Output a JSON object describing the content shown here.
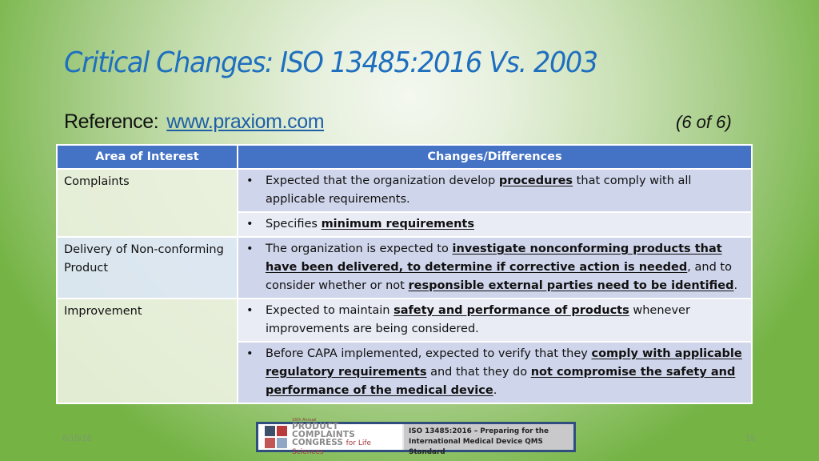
{
  "slide": {
    "title": "Critical Changes:  ISO 13485:2016 Vs. 2003",
    "reference_label": "Reference:",
    "reference_link": "www.praxiom.com",
    "pager": "(6 of 6)"
  },
  "table": {
    "headers": [
      "Area of Interest",
      "Changes/Differences"
    ],
    "rows": [
      {
        "area": "Complaints",
        "changes": [
          [
            {
              "t": "Expected that the organization develop "
            },
            {
              "t": "procedures",
              "b": true
            },
            {
              "t": " that comply with all applicable requirements."
            }
          ],
          [
            {
              "t": "Specifies "
            },
            {
              "t": "minimum requirements",
              "b": true
            }
          ]
        ]
      },
      {
        "area": "Delivery of Non-conforming Product",
        "changes": [
          [
            {
              "t": "The organization is expected to "
            },
            {
              "t": "investigate nonconforming products that have been delivered, to determine if corrective action is needed",
              "b": true
            },
            {
              "t": ", and to consider whether or not "
            },
            {
              "t": "responsible external parties need to be identified",
              "b": true
            },
            {
              "t": "."
            }
          ]
        ]
      },
      {
        "area": "Improvement",
        "changes": [
          [
            {
              "t": "Expected to maintain "
            },
            {
              "t": "safety and performance of products",
              "b": true
            },
            {
              "t": " whenever improvements are being considered."
            }
          ],
          [
            {
              "t": "Before CAPA implemented, expected to verify that they "
            },
            {
              "t": "comply with applicable regulatory requirements",
              "b": true
            },
            {
              "t": " and that they do "
            },
            {
              "t": "not compromise the safety and performance of the medical device",
              "b": true
            },
            {
              "t": "."
            }
          ]
        ]
      }
    ],
    "bullet": "•"
  },
  "footer": {
    "date": "6/15/18",
    "page_number": "19",
    "banner": {
      "logo_small": "16th Annual",
      "logo_line1": "PRODUCT COMPLAINTS",
      "logo_line2": "CONGRESS",
      "logo_line2_suffix": "for Life Sciences",
      "right_line1": "ISO 13485:2016 – Preparing for the",
      "right_line2": "International Medical Device QMS Standard"
    }
  },
  "colors": {
    "title": "#1f6fbf",
    "header_bg": "#4472c4",
    "row_dark": "#cfd5ea",
    "row_light": "#e9ebf5",
    "banner_border": "#2f4e7e"
  }
}
